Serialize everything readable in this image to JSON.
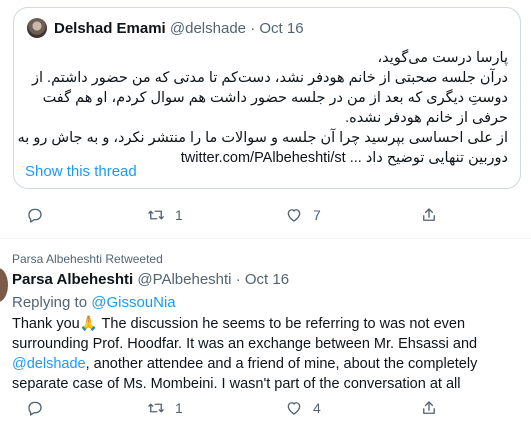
{
  "quoted_tweet": {
    "author_name": "Delshad Emami",
    "handle": "@delshade",
    "separator": "·",
    "date": "Oct 16",
    "lines": [
      "پارسا درست می‌گوید،",
      "درآن جلسه صحبتی از خانم هودفر نشد، دست‌کم تا مدتی که من حضور داشتم. از",
      "دوستِ دیگری که بعد از من در جلسه حضور داشت هم سوال کردم، او هم گفت",
      "حرفی از خانم هودفر نشده.",
      "از علی احساسی بپرسید چرا آن جلسه و سوالات ما را منتشر نکرد، و به جاش رو به",
      "دوربین تنهایی توضیح داد ... twitter.com/PAlbeheshti/st"
    ],
    "show_thread": "Show this thread",
    "actions": {
      "reply_count": "",
      "retweet_count": "1",
      "like_count": "7"
    }
  },
  "retweet_label": "Parsa Albeheshti Retweeted",
  "tweet": {
    "author_name": "Parsa Albeheshti",
    "handle": "@PAlbeheshti",
    "separator": "·",
    "date": "Oct 16",
    "replying_prefix": "Replying to ",
    "replying_to": "@GissouNia",
    "line1_text": "Thank you",
    "line1_emoji": "🙏",
    "line1_rest": " The discussion he seems to be referring to was not even",
    "line2": "surrounding Prof. Hoodfar. It was an exchange between Mr. Ehsassi and",
    "line3_mention": "@delshade",
    "line3_rest": ", another attendee and a friend of mine, about the completely",
    "line4": "separate case of Ms. Mombeini. I wasn't part of the conversation at all",
    "actions": {
      "reply_count": "",
      "retweet_count": "1",
      "like_count": "4"
    }
  },
  "colors": {
    "link": "#1d9bf0",
    "secondary": "#536471",
    "text": "#0f1419",
    "border": "#cfd9de"
  },
  "icons": [
    "reply-icon",
    "retweet-icon",
    "like-icon",
    "share-icon",
    "retweet-small-icon"
  ]
}
